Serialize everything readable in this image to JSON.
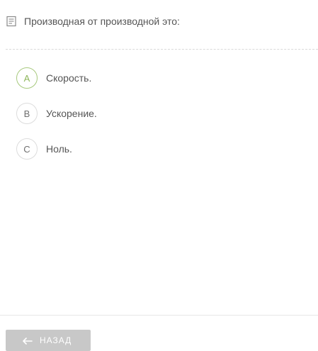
{
  "question": {
    "text": "Производная от производной это:",
    "icon": "document-icon"
  },
  "options": [
    {
      "letter": "A",
      "text": "Скорость.",
      "selected": true
    },
    {
      "letter": "B",
      "text": "Ускорение.",
      "selected": false
    },
    {
      "letter": "C",
      "text": "Ноль.",
      "selected": false
    }
  ],
  "footer": {
    "back_label": "НАЗАД"
  },
  "colors": {
    "accent": "#8db65a",
    "button_bg": "#c8c8c8"
  }
}
